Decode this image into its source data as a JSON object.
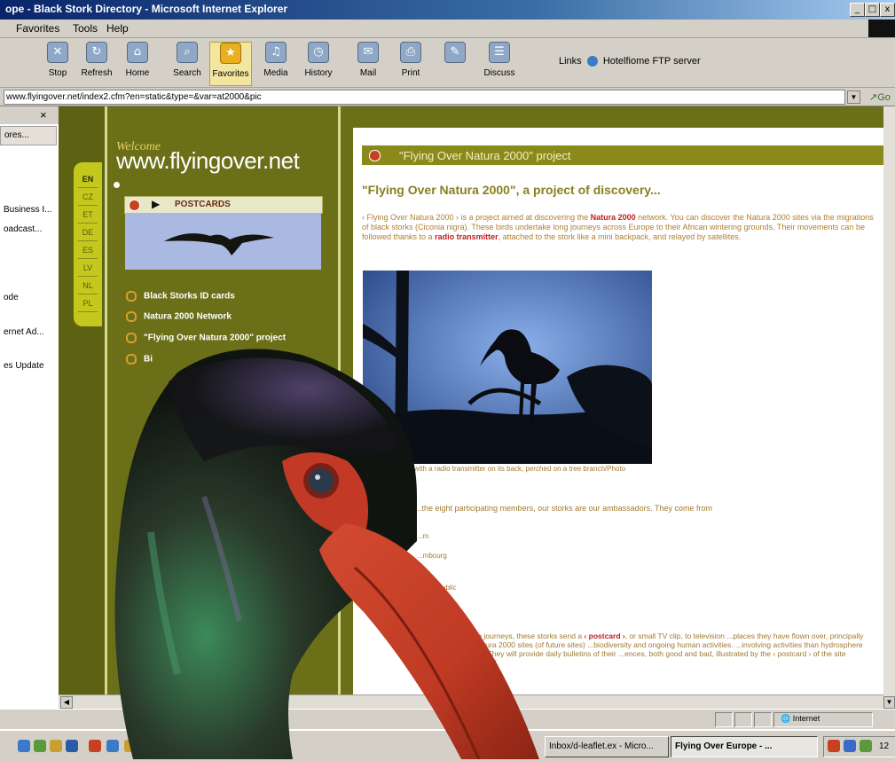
{
  "window": {
    "title": "ope - Black Stork Directory - Microsoft Internet Explorer",
    "controls": [
      "_",
      "□",
      "x"
    ]
  },
  "menu": {
    "items": [
      "Favorites",
      "Tools",
      "Help"
    ]
  },
  "toolbar": {
    "buttons": [
      {
        "label": "Stop",
        "icon": "stop-icon"
      },
      {
        "label": "Refresh",
        "icon": "refresh-icon"
      },
      {
        "label": "Home",
        "icon": "home-icon"
      },
      {
        "label": "Search",
        "icon": "search-icon"
      },
      {
        "label": "Favorites",
        "icon": "favorites-icon"
      },
      {
        "label": "Media",
        "icon": "media-icon"
      },
      {
        "label": "History",
        "icon": "history-icon"
      },
      {
        "label": "Mail",
        "icon": "mail-icon"
      },
      {
        "label": "Print",
        "icon": "print-icon"
      },
      {
        "label": "",
        "icon": "edit-icon"
      },
      {
        "label": "Discuss",
        "icon": "discuss-icon"
      }
    ],
    "links_label": "Links",
    "links_item": "Hotelfiome FTP server"
  },
  "address": {
    "url": "www.flyingover.net/index2.cfm?en=static&type=&var=at2000&pic"
  },
  "left_panel": {
    "close": "×",
    "header": "ores...",
    "items": [
      "Business I...",
      "oadcast...",
      "ode",
      "ernet Ad...",
      "es Update"
    ]
  },
  "site": {
    "welcome": "Welcome",
    "domain": "www.flyingover.net",
    "languages": [
      "EN",
      "CZ",
      "ET",
      "DE",
      "ES",
      "LV",
      "NL",
      "PL"
    ],
    "postcards_label": "POSTCARDS",
    "nav": [
      "Black Storks ID cards",
      "Natura 2000 Network",
      "\"Flying Over Natura 2000\" project",
      "Bi",
      "",
      ""
    ],
    "content_header": "\"Flying Over Natura 2000\" project",
    "content_title": "\"Flying Over Natura 2000\", a project of discovery...",
    "para_a": "‹ Flying Over Natura 2000 › is a project aimed at discovering the ",
    "para_link1": "Natura 2000",
    "para_b": " network. You can discover the Natura 2000 sites via the migrations of black storks (Ciconia nigra). These birds undertake long journeys across Europe to their African wintering grounds. Their movements can be followed thanks to a ",
    "para_link2": "radio transmitter",
    "para_c": ", attached to the stork like a mini backpack, and relayed by satellites.",
    "caption": "...with a radio transmitter on its back, perched on a tree branch/Photo",
    "para2": "...the eight participating members, our storks are our ambassadors. They come from",
    "countries": [
      "...m",
      "...mbourg",
      "...e",
      "...h Republic"
    ],
    "para3_a": "...long journeys, these storks send a ",
    "para3_link": "‹ postcard ›",
    "para3_b": ", or small TV clip, to television ...places they have flown over, principally the Natura 2000 sites (of future sites) ...biodiversity and ongoing human activities. ...involving activities than hydrosphere stories. They will provide daily bulletins of their ...ences, both good and bad, illustrated by the ‹ postcard › of the site concerned."
  },
  "statusbar": {
    "zone": "Internet"
  },
  "taskbar": {
    "tasks": [
      "Inbox/d-leaflet.ex - Micro...",
      "Flying Over Europe - ..."
    ],
    "clock": "12"
  }
}
